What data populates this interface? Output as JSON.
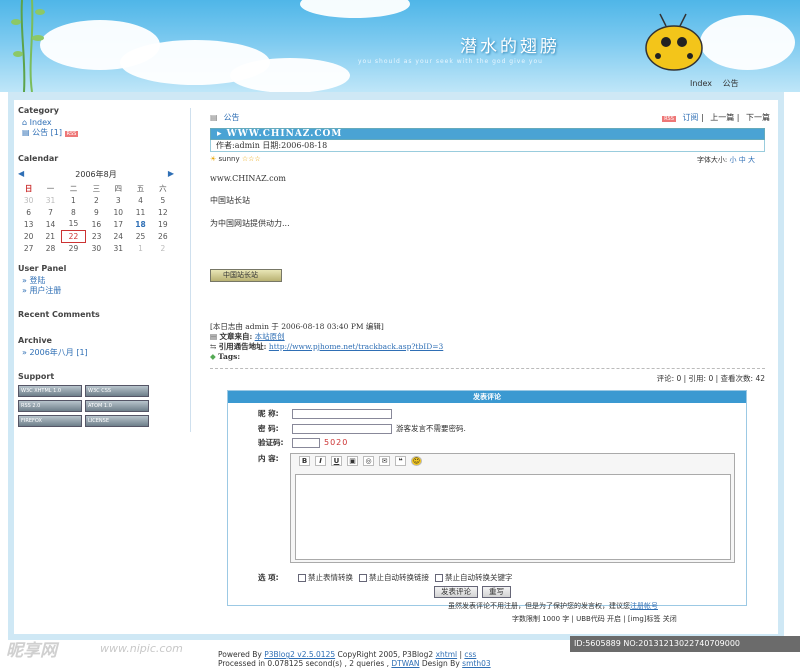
{
  "header": {
    "title": "潜水的翅膀",
    "subtitle": "you should as your seek with the god give you",
    "nav": [
      "Index",
      "公告"
    ]
  },
  "sidebar": {
    "category_title": "Category",
    "category_items": [
      "Index",
      "公告 [1]"
    ],
    "calendar_title": "Calendar",
    "month_label": "2006年8月",
    "weekdays": [
      "日",
      "一",
      "二",
      "三",
      "四",
      "五",
      "六"
    ],
    "weeks": [
      [
        "30",
        "31",
        "1",
        "2",
        "3",
        "4",
        "5"
      ],
      [
        "6",
        "7",
        "8",
        "9",
        "10",
        "11",
        "12"
      ],
      [
        "13",
        "14",
        "15",
        "16",
        "17",
        "18",
        "19"
      ],
      [
        "20",
        "21",
        "22",
        "23",
        "24",
        "25",
        "26"
      ],
      [
        "27",
        "28",
        "29",
        "30",
        "31",
        "1",
        "2"
      ]
    ],
    "user_panel_title": "User Panel",
    "user_panel_items": [
      "登陆",
      "用户注册"
    ],
    "recent_comments_title": "Recent Comments",
    "archive_title": "Archive",
    "archive_items": [
      "2006年八月 [1]"
    ],
    "support_title": "Support"
  },
  "post": {
    "category": "公告",
    "nav": [
      "订阅",
      "上一篇",
      "下一篇"
    ],
    "title": "WWW.CHINAZ.COM",
    "meta": "作者:admin 日期:2006-08-18",
    "mood": "sunny",
    "font_size_label": "字体大小:",
    "font_sizes": [
      "小",
      "中",
      "大"
    ],
    "paragraphs": [
      "www.CHINAZ.com",
      "中国站长站",
      "为中国网站提供动力..."
    ],
    "logo_text": "中国站长站",
    "edit_note": "[本日志由 admin 于 2006-08-18 03:40 PM 编辑]",
    "source_label": "文章来自:",
    "source_value": "本站原创",
    "trackback_label": "引用通告地址:",
    "trackback_url": "http://www.pjhome.net/trackback.asp?tbID=3",
    "tags_label": "Tags:",
    "stats": "评论: 0 | 引用: 0 | 查看次数: 42"
  },
  "comment_form": {
    "title": "发表评论",
    "nickname_label": "昵 称:",
    "password_label": "密 码:",
    "password_hint": "游客发言不需要密码.",
    "captcha_label": "验证码:",
    "captcha_code": "5020",
    "content_label": "内 容:",
    "toolbar": [
      "B",
      "I",
      "U"
    ],
    "options_label": "选 项:",
    "options": [
      "禁止表情转换",
      "禁止自动转换链接",
      "禁止自动转换关键字"
    ],
    "submit_label": "发表评论",
    "reset_label": "重写",
    "note": "虽然发表评论不用注册，但是为了保护您的发言权，建议您",
    "note_link": "注册帐号",
    "limits": "字数限制 1000 字 | UBB代码 开启 | [img]标签 关闭"
  },
  "footer": {
    "line1_prefix": "Powered By",
    "version": "P3Blog2 v2.5.0125",
    "line1_rest": "CopyRight 2005, P3Blog2",
    "xhtml": "xhtml",
    "css": "css",
    "line2_prefix": "Processed in 0.078125 second(s) , 2 queries ,",
    "line2_design": "DTWAN",
    "line2_design_by": "Design By",
    "line2_author": "smth03"
  },
  "watermark": {
    "left": "昵享网",
    "url": "www.nipic.com",
    "right": "ID:5605889 NO:20131213022740709000"
  }
}
